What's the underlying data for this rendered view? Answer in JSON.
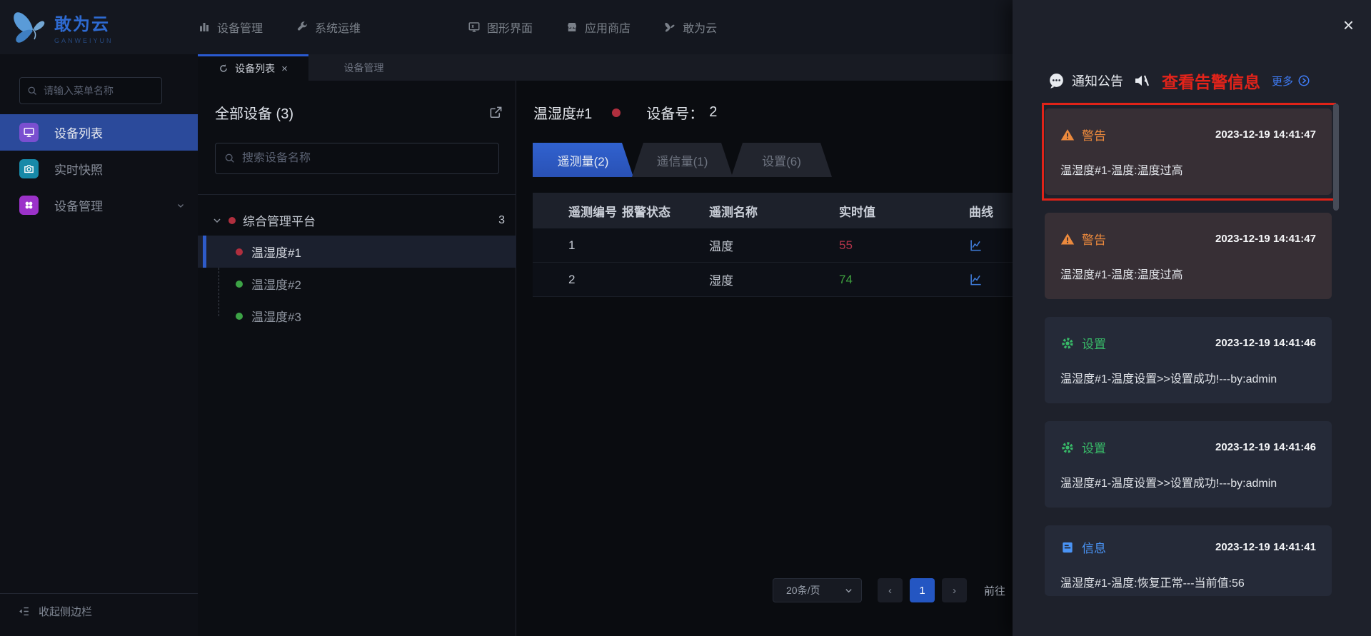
{
  "colors": {
    "accent_blue": "#2a5ad0",
    "active_menu_blue": "#2b4a9b",
    "alarm_red": "#b02f3e",
    "ok_green": "#3da346",
    "value_high_red": "#b03349",
    "value_normal_green": "#3fa23f",
    "warning_orange": "#ec8a3d",
    "setting_green": "#38b968",
    "info_blue": "#4a94f6",
    "annotation_red": "#e02318",
    "panel_bg": "#1e212b",
    "warn_card_bg": "#372f35",
    "cool_card_bg": "#252a38"
  },
  "navbar": {
    "logo": {
      "title": "敢为云",
      "subtitle": "GANWEIYUN"
    },
    "items": [
      {
        "label": "设备管理",
        "icon": "device-manage-icon",
        "active": true
      },
      {
        "label": "系统运维",
        "icon": "wrench-icon"
      },
      {
        "label": "图形界面",
        "icon": "monitor-icon"
      },
      {
        "label": "应用商店",
        "icon": "store-icon"
      },
      {
        "label": "敢为云",
        "icon": "butterfly-icon"
      }
    ]
  },
  "tabbar": {
    "tabs": [
      {
        "label": "设备列表",
        "active": true,
        "closable": true
      },
      {
        "label": "设备管理"
      }
    ],
    "close_glyph": "×"
  },
  "sidebar": {
    "search_placeholder": "请输入菜单名称",
    "items": [
      {
        "label": "设备列表",
        "active": true
      },
      {
        "label": "实时快照"
      },
      {
        "label": "设备管理",
        "has_submenu": true
      }
    ],
    "collapse_label": "收起侧边栏"
  },
  "device_panel": {
    "title": "全部设备 (3)",
    "search_placeholder": "搜索设备名称",
    "root": {
      "label": "综合管理平台",
      "count": "3",
      "status": "alarm"
    },
    "devices": [
      {
        "label": "温湿度#1",
        "status": "alarm",
        "selected": true
      },
      {
        "label": "温湿度#2",
        "status": "ok"
      },
      {
        "label": "温湿度#3",
        "status": "ok"
      }
    ]
  },
  "main": {
    "device_name": "温湿度#1",
    "device_status": "alarm",
    "device_no_label": "设备号：",
    "device_no": "2",
    "tabs": [
      {
        "label": "遥测量(2)",
        "active": true
      },
      {
        "label": "遥信量(1)"
      },
      {
        "label": "设置(6)"
      }
    ],
    "table": {
      "headers": [
        "遥测编号",
        "报警状态",
        "遥测名称",
        "实时值",
        "曲线"
      ],
      "rows": [
        {
          "no": "1",
          "alarm": "alarm",
          "name": "温度",
          "value": "55",
          "value_state": "high"
        },
        {
          "no": "2",
          "alarm": "ok",
          "name": "湿度",
          "value": "74",
          "value_state": "normal"
        }
      ]
    },
    "pagination": {
      "size": "20条/页",
      "prev": "‹",
      "page": "1",
      "next": "›",
      "goto_label": "前往"
    }
  },
  "notice": {
    "title": "通知公告",
    "annotation": "查看告警信息",
    "more_label": "更多",
    "cards": [
      {
        "type": "warning",
        "type_label": "警告",
        "time": "2023-12-19 14:41:47",
        "body": "温湿度#1-温度:温度过高",
        "highlighted": true
      },
      {
        "type": "warning",
        "type_label": "警告",
        "time": "2023-12-19 14:41:47",
        "body": "温湿度#1-温度:温度过高"
      },
      {
        "type": "setting",
        "type_label": "设置",
        "time": "2023-12-19 14:41:46",
        "body": "温湿度#1-温度设置>>设置成功!---by:admin"
      },
      {
        "type": "setting",
        "type_label": "设置",
        "time": "2023-12-19 14:41:46",
        "body": "温湿度#1-温度设置>>设置成功!---by:admin"
      },
      {
        "type": "info",
        "type_label": "信息",
        "time": "2023-12-19 14:41:41",
        "body": "温湿度#1-温度:恢复正常---当前值:56"
      }
    ]
  }
}
